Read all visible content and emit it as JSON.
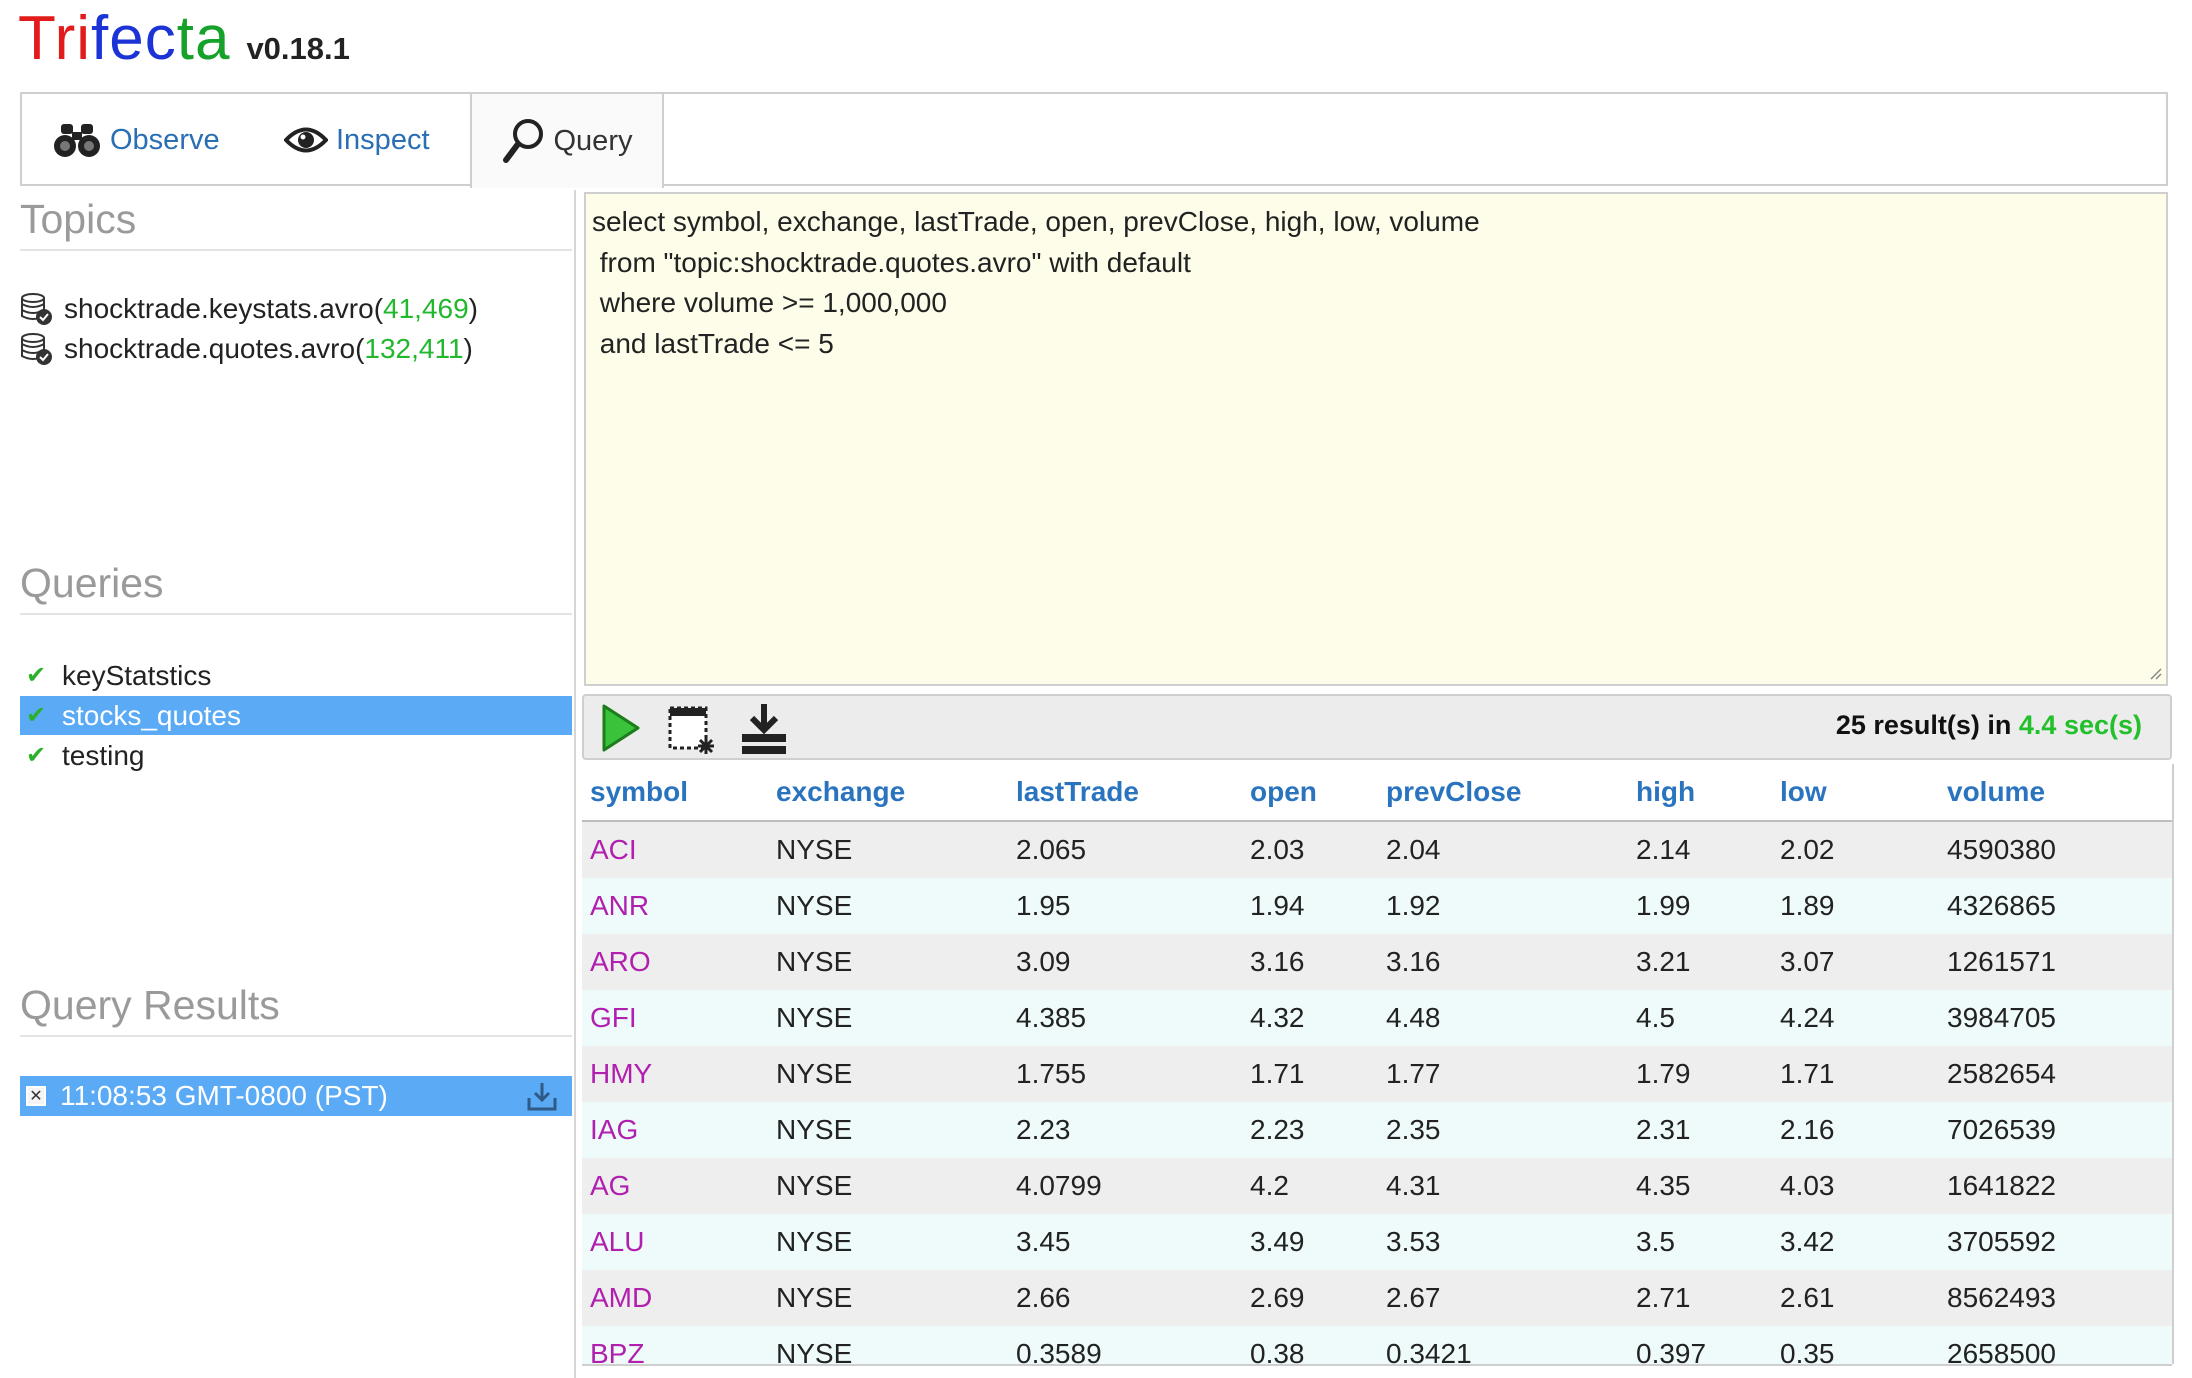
{
  "app": {
    "logo_parts": [
      "Tri",
      "fec",
      "ta"
    ],
    "version": "v0.18.1"
  },
  "tabs": [
    {
      "label": "Observe",
      "icon": "binoculars-icon"
    },
    {
      "label": "Inspect",
      "icon": "eye-icon"
    },
    {
      "label": "Query",
      "icon": "magnifier-icon",
      "active": true
    }
  ],
  "sidebar": {
    "topics_title": "Topics",
    "topics": [
      {
        "name": "shocktrade.keystats.avro",
        "open": " (",
        "count": "41,469",
        "close": ")"
      },
      {
        "name": "shocktrade.quotes.avro",
        "open": " (",
        "count": "132,411",
        "close": ")"
      }
    ],
    "queries_title": "Queries",
    "queries": [
      {
        "label": "keyStatstics",
        "selected": false
      },
      {
        "label": "stocks_quotes",
        "selected": true
      },
      {
        "label": "testing",
        "selected": false
      }
    ],
    "results_title": "Query Results",
    "results": [
      {
        "label": "11:08:53 GMT-0800 (PST)",
        "close_glyph": "✕"
      }
    ]
  },
  "editor": {
    "query_text": "select symbol, exchange, lastTrade, open, prevClose, high, low, volume\n from \"topic:shocktrade.quotes.avro\" with default\n where volume >= 1,000,000\n and lastTrade <= 5"
  },
  "toolbar": {
    "count_text": "25 result(s) in ",
    "time_text": "4.4 sec(s)"
  },
  "colors": {
    "selected_bg": "#5aaaf6",
    "link_blue": "#2a74bf",
    "symbol_magenta": "#b01fae",
    "count_green": "#22b82e",
    "editor_bg": "#fdfde9"
  },
  "results_table": {
    "columns": [
      "symbol",
      "exchange",
      "lastTrade",
      "open",
      "prevClose",
      "high",
      "low",
      "volume"
    ],
    "rows": [
      [
        "ACI",
        "NYSE",
        "2.065",
        "2.03",
        "2.04",
        "2.14",
        "2.02",
        "4590380"
      ],
      [
        "ANR",
        "NYSE",
        "1.95",
        "1.94",
        "1.92",
        "1.99",
        "1.89",
        "4326865"
      ],
      [
        "ARO",
        "NYSE",
        "3.09",
        "3.16",
        "3.16",
        "3.21",
        "3.07",
        "1261571"
      ],
      [
        "GFI",
        "NYSE",
        "4.385",
        "4.32",
        "4.48",
        "4.5",
        "4.24",
        "3984705"
      ],
      [
        "HMY",
        "NYSE",
        "1.755",
        "1.71",
        "1.77",
        "1.79",
        "1.71",
        "2582654"
      ],
      [
        "IAG",
        "NYSE",
        "2.23",
        "2.23",
        "2.35",
        "2.31",
        "2.16",
        "7026539"
      ],
      [
        "AG",
        "NYSE",
        "4.0799",
        "4.2",
        "4.31",
        "4.35",
        "4.03",
        "1641822"
      ],
      [
        "ALU",
        "NYSE",
        "3.45",
        "3.49",
        "3.53",
        "3.5",
        "3.42",
        "3705592"
      ],
      [
        "AMD",
        "NYSE",
        "2.66",
        "2.69",
        "2.67",
        "2.71",
        "2.61",
        "8562493"
      ],
      [
        "BPZ",
        "NYSE",
        "0.3589",
        "0.38",
        "0.3421",
        "0.397",
        "0.35",
        "2658500"
      ]
    ]
  }
}
